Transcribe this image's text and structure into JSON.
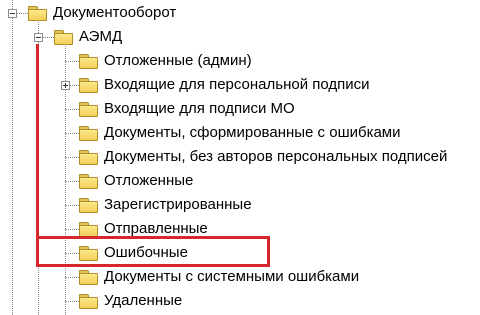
{
  "tree": {
    "root": {
      "label": "Документооборот",
      "expanded": true
    },
    "aemd": {
      "label": "АЭМД",
      "expanded": true
    },
    "children": [
      {
        "label": "Отложенные (админ)",
        "has_children": false
      },
      {
        "label": "Входящие для персональной подписи",
        "has_children": true
      },
      {
        "label": "Входящие для подписи МО",
        "has_children": false
      },
      {
        "label": "Документы, сформированные с ошибками",
        "has_children": false
      },
      {
        "label": "Документы, без авторов персональных подписей",
        "has_children": false
      },
      {
        "label": "Отложенные",
        "has_children": false
      },
      {
        "label": "Зарегистрированные",
        "has_children": false
      },
      {
        "label": "Отправленные",
        "has_children": false
      },
      {
        "label": "Ошибочные",
        "has_children": false,
        "highlighted": true
      },
      {
        "label": "Документы с системными ошибками",
        "has_children": false
      },
      {
        "label": "Удаленные",
        "has_children": false
      }
    ]
  },
  "colors": {
    "highlight": "#d6272d",
    "folder_fill": "#f7dc74",
    "folder_edge": "#b08f27",
    "tree_lines": "#8a8a8a"
  },
  "icons": {
    "folder": "folder-icon",
    "expand": "plus-expander-icon",
    "collapse": "minus-expander-icon"
  }
}
